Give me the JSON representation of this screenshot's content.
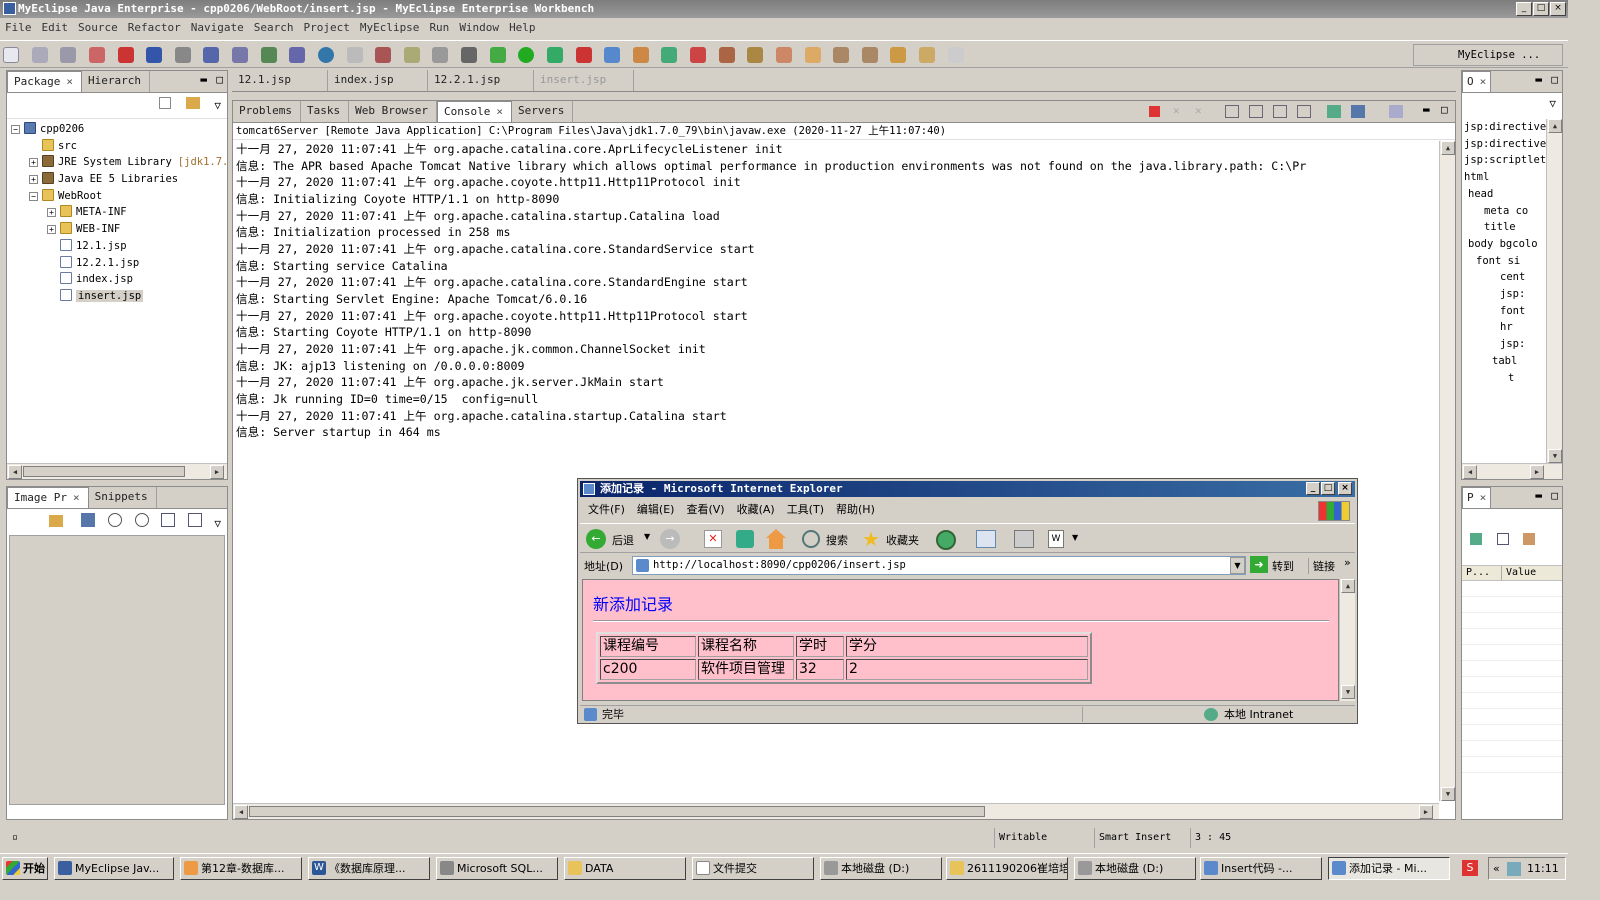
{
  "window": {
    "title": "MyEclipse Java Enterprise - cpp0206/WebRoot/insert.jsp - MyEclipse Enterprise Workbench",
    "min": "_",
    "max": "□",
    "close": "×"
  },
  "menu": [
    "File",
    "Edit",
    "Source",
    "Refactor",
    "Navigate",
    "Search",
    "Project",
    "MyEclipse",
    "Run",
    "Window",
    "Help"
  ],
  "perspective": "MyEclipse ...",
  "package_panel": {
    "tabs": [
      "Package",
      "Hierarch"
    ],
    "tree": [
      {
        "label": "cpp0206",
        "indent": 0,
        "icon": "proj",
        "exp": "-"
      },
      {
        "label": "src",
        "indent": 1,
        "icon": "folder",
        "exp": ""
      },
      {
        "label": "JRE System Library",
        "suffix": "[jdk1.7.",
        "indent": 1,
        "icon": "jar",
        "exp": "+"
      },
      {
        "label": "Java EE 5 Libraries",
        "indent": 1,
        "icon": "jar",
        "exp": "+"
      },
      {
        "label": "WebRoot",
        "indent": 1,
        "icon": "folder",
        "exp": "-"
      },
      {
        "label": "META-INF",
        "indent": 2,
        "icon": "folder",
        "exp": "+"
      },
      {
        "label": "WEB-INF",
        "indent": 2,
        "icon": "folder",
        "exp": "+"
      },
      {
        "label": "12.1.jsp",
        "indent": 2,
        "icon": "jsp",
        "exp": ""
      },
      {
        "label": "12.2.1.jsp",
        "indent": 2,
        "icon": "jsp",
        "exp": ""
      },
      {
        "label": "index.jsp",
        "indent": 2,
        "icon": "jsp",
        "exp": ""
      },
      {
        "label": "insert.jsp",
        "indent": 2,
        "icon": "jsp",
        "exp": "",
        "selected": true
      }
    ]
  },
  "image_panel": {
    "tabs": [
      "Image Pr",
      "Snippets"
    ]
  },
  "editor_tabs": [
    "12.1.jsp",
    "index.jsp",
    "12.2.1.jsp",
    "insert.jsp"
  ],
  "console_panel": {
    "tabs": [
      "Problems",
      "Tasks",
      "Web Browser",
      "Console",
      "Servers"
    ],
    "header": "tomcat6Server [Remote Java Application] C:\\Program Files\\Java\\jdk1.7.0_79\\bin\\javaw.exe (2020-11-27 上午11:07:40)",
    "lines": [
      "十一月 27, 2020 11:07:41 上午 org.apache.catalina.core.AprLifecycleListener init",
      "信息: The APR based Apache Tomcat Native library which allows optimal performance in production environments was not found on the java.library.path: C:\\Pr",
      "十一月 27, 2020 11:07:41 上午 org.apache.coyote.http11.Http11Protocol init",
      "信息: Initializing Coyote HTTP/1.1 on http-8090",
      "十一月 27, 2020 11:07:41 上午 org.apache.catalina.startup.Catalina load",
      "信息: Initialization processed in 258 ms",
      "十一月 27, 2020 11:07:41 上午 org.apache.catalina.core.StandardService start",
      "信息: Starting service Catalina",
      "十一月 27, 2020 11:07:41 上午 org.apache.catalina.core.StandardEngine start",
      "信息: Starting Servlet Engine: Apache Tomcat/6.0.16",
      "十一月 27, 2020 11:07:41 上午 org.apache.coyote.http11.Http11Protocol start",
      "信息: Starting Coyote HTTP/1.1 on http-8090",
      "十一月 27, 2020 11:07:41 上午 org.apache.jk.common.ChannelSocket init",
      "信息: JK: ajp13 listening on /0.0.0.0:8009",
      "十一月 27, 2020 11:07:41 上午 org.apache.jk.server.JkMain start",
      "信息: Jk running ID=0 time=0/15  config=null",
      "十一月 27, 2020 11:07:41 上午 org.apache.catalina.startup.Catalina start",
      "信息: Server startup in 464 ms"
    ]
  },
  "outline_panel": {
    "tab": "O",
    "items": [
      "jsp:directive.",
      "jsp:directive.",
      "jsp:scriptlet",
      "html",
      "head",
      "meta co",
      "title",
      "body bgcolo",
      "font si",
      "cent",
      "jsp:",
      "font",
      "hr",
      "jsp:",
      "tabl",
      "t"
    ]
  },
  "props_panel": {
    "tab": "P",
    "cols": [
      "P...",
      "Value"
    ]
  },
  "ie": {
    "title": "添加记录 - Microsoft Internet Explorer",
    "menu": [
      "文件(F)",
      "编辑(E)",
      "查看(V)",
      "收藏(A)",
      "工具(T)",
      "帮助(H)"
    ],
    "back": "后退",
    "search": "搜索",
    "favorites": "收藏夹",
    "addr_label": "地址(D)",
    "url": "http://localhost:8090/cpp0206/insert.jsp",
    "go": "转到",
    "links": "链接",
    "heading": "新添加记录",
    "table": {
      "headers": [
        "课程编号",
        "课程名称",
        "学时",
        "学分"
      ],
      "row": [
        "c200",
        "软件项目管理",
        "32",
        "2"
      ]
    },
    "status": "完毕",
    "zone": "本地 Intranet"
  },
  "statusbar": {
    "writable": "Writable",
    "insert": "Smart Insert",
    "pos": "3 : 45"
  },
  "taskbar": {
    "start": "开始",
    "items": [
      "MyEclipse Jav...",
      "第12章-数据库...",
      "《数据库原理...",
      "Microsoft SQL...",
      "DATA",
      "文件提交",
      "本地磁盘 (D:)",
      "2611190206崔培培",
      "本地磁盘 (D:)",
      "Insert代码 -...",
      "添加记录 - Mi..."
    ],
    "clock": "11:11"
  }
}
